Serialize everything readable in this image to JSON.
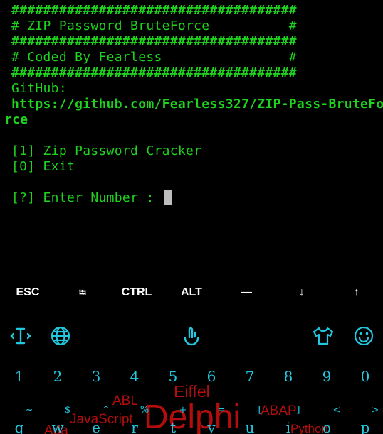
{
  "terminal": {
    "lines": [
      "####################################",
      "# ZIP Password BruteForce          #",
      "####################################",
      "# Coded By Fearless                #",
      "####################################",
      "GitHub:",
      "https://github.com/Fearless327/ZIP-Pass-BruteFo",
      "rce",
      "[1] Zip Password Cracker",
      "[0] Exit",
      "[?] Enter Number : "
    ]
  },
  "extra_keys": [
    "ESC",
    "⭾",
    "CTRL",
    "ALT",
    "—",
    "↓",
    "↑"
  ],
  "keyboard": {
    "toolbar_icons": [
      "text-cursor-icon",
      "globe-icon",
      "touch-icon",
      "shirt-icon",
      "smiley-icon"
    ],
    "number_row": [
      "1",
      "2",
      "3",
      "4",
      "5",
      "6",
      "7",
      "8",
      "9",
      "0"
    ],
    "symbol_row": [
      "~",
      "$",
      "^",
      "%",
      "+",
      "=",
      "[",
      "]",
      "<",
      ">"
    ],
    "letter_row": [
      "q",
      "w",
      "e",
      "r",
      "t",
      "y",
      "u",
      "i",
      "o",
      "p"
    ],
    "theme_words": [
      "ABL",
      "Eiffel",
      "JavaScript",
      "Delphi",
      "ABAP",
      "Python",
      "Ada"
    ],
    "colors": {
      "accent": "#22c8e0",
      "terminal_text": "#1ed21e",
      "theme_text": "#b30d0d"
    }
  }
}
